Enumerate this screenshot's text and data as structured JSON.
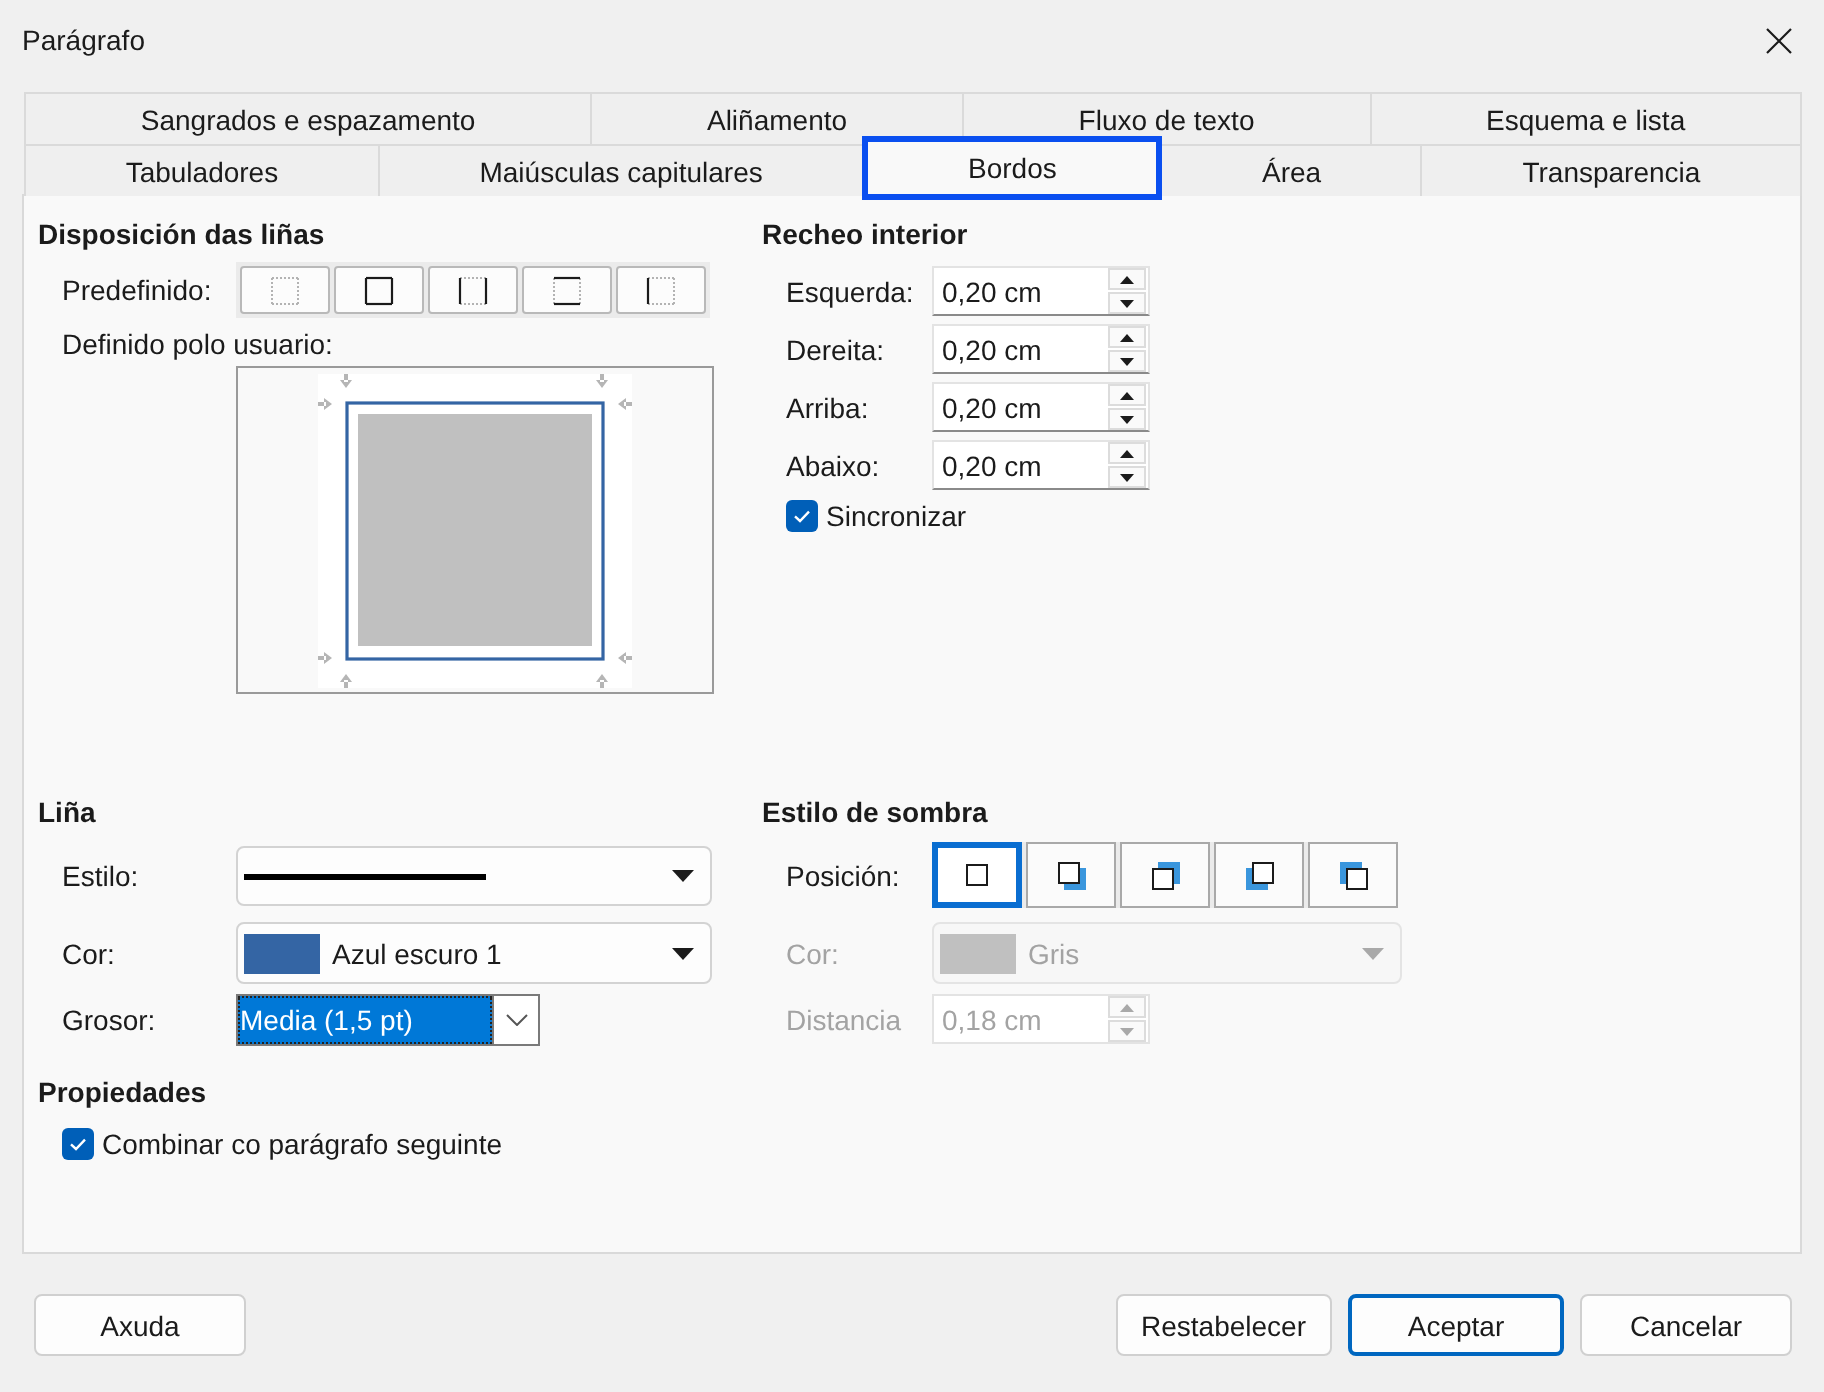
{
  "window": {
    "title": "Parágrafo"
  },
  "tab_rows": [
    {
      "tabs": [
        {
          "label": "Sangrados e espazamento",
          "selected": false
        },
        {
          "label": "Aliñamento",
          "selected": false
        },
        {
          "label": "Fluxo de texto",
          "selected": false
        },
        {
          "label": "Esquema e lista",
          "selected": false
        }
      ]
    },
    {
      "tabs": [
        {
          "label": "Tabuladores",
          "selected": false
        },
        {
          "label": "Maiúsculas capitulares",
          "selected": false
        },
        {
          "label": "Bordos",
          "selected": true
        },
        {
          "label": "Área",
          "selected": false
        },
        {
          "label": "Transparencia",
          "selected": false
        }
      ]
    }
  ],
  "line_arrangement": {
    "title": "Disposición das liñas",
    "presets_label": "Predefinido:",
    "presets": [
      {
        "kind": "none"
      },
      {
        "kind": "box"
      },
      {
        "kind": "left-right"
      },
      {
        "kind": "top-bottom"
      },
      {
        "kind": "left"
      }
    ],
    "user_defined_label": "Definido polo usuario:"
  },
  "padding": {
    "title": "Recheo interior",
    "fields": [
      {
        "label": "Esquerda:",
        "value": "0,20 cm"
      },
      {
        "label": "Dereita:",
        "value": "0,20 cm"
      },
      {
        "label": "Arriba:",
        "value": "0,20 cm"
      },
      {
        "label": "Abaixo:",
        "value": "0,20 cm"
      }
    ],
    "sync": {
      "label": "Sincronizar",
      "checked": true
    }
  },
  "line": {
    "title": "Liña",
    "style": {
      "label": "Estilo:"
    },
    "color": {
      "label": "Cor:",
      "value": "Azul escuro 1",
      "color": "#3465a4"
    },
    "width": {
      "label": "Grosor:",
      "value": "Media (1,5 pt)"
    }
  },
  "properties": {
    "title": "Propiedades",
    "merge": {
      "label": "Combinar co parágrafo seguinte",
      "checked": true
    }
  },
  "shadow": {
    "title": "Estilo de sombra",
    "position_label": "Posición:",
    "positions": [
      {
        "kind": "none",
        "selected": true
      },
      {
        "kind": "bottom-right",
        "selected": false
      },
      {
        "kind": "top-right",
        "selected": false
      },
      {
        "kind": "bottom-left",
        "selected": false
      },
      {
        "kind": "top-left",
        "selected": false
      }
    ],
    "color": {
      "label": "Cor:",
      "value": "Gris",
      "color": "#c0c0c0",
      "disabled": true
    },
    "distance": {
      "label": "Distancia",
      "value": "0,18 cm",
      "disabled": true
    }
  },
  "buttons": [
    {
      "label": "Axuda",
      "kind": "help"
    },
    {
      "label": "Restabelecer",
      "kind": "normal"
    },
    {
      "label": "Aceptar",
      "kind": "default"
    },
    {
      "label": "Cancelar",
      "kind": "normal"
    }
  ]
}
